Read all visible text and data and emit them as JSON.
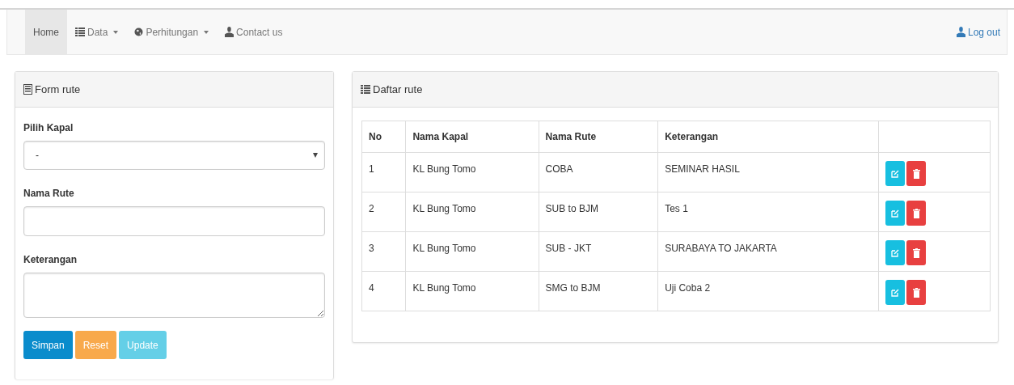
{
  "navbar": {
    "items": [
      {
        "label": "Home",
        "dropdown": false,
        "selected": true
      },
      {
        "label": "Data",
        "dropdown": true,
        "selected": false
      },
      {
        "label": "Perhitungan",
        "dropdown": true,
        "selected": false
      },
      {
        "label": "Contact us",
        "dropdown": false,
        "selected": false
      }
    ],
    "logout": {
      "label": "Log out"
    }
  },
  "form_panel": {
    "title": "Form rute",
    "fields": [
      {
        "kind": "select",
        "label": "Pilih Kapal",
        "value": "-"
      },
      {
        "kind": "text",
        "label": "Nama Rute"
      },
      {
        "kind": "textarea",
        "label": "Keterangan"
      }
    ],
    "buttons": [
      {
        "label": "Simpan",
        "kind": "primary",
        "disabled": false
      },
      {
        "label": "Reset",
        "kind": "warning",
        "disabled": false
      },
      {
        "label": "Update",
        "kind": "info",
        "disabled": true
      }
    ]
  },
  "list_panel": {
    "title": "Daftar rute",
    "table": {
      "columns": [
        "No",
        "Nama Kapal",
        "Nama Rute",
        "Keterangan"
      ],
      "rows": [
        [
          "1",
          "KL Bung Tomo",
          "COBA",
          "SEMINAR HASIL"
        ],
        [
          "2",
          "KL Bung Tomo",
          "SUB to BJM",
          "Tes 1"
        ],
        [
          "3",
          "KL Bung Tomo",
          "SUB - JKT",
          "SURABAYA TO JAKARTA"
        ],
        [
          "4",
          "KL Bung Tomo",
          "SMG to BJM",
          "Uji Coba 2"
        ]
      ]
    }
  }
}
